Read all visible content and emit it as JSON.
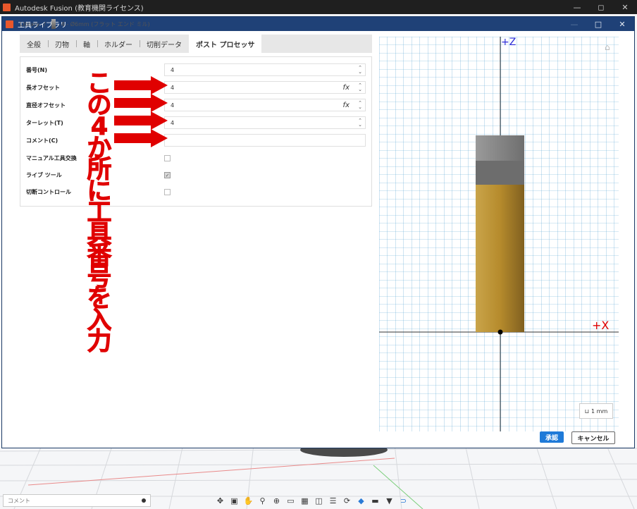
{
  "app": {
    "title": "Autodesk Fusion (教育機関ライセンス)",
    "window_controls": [
      "—",
      "◻",
      "✕"
    ]
  },
  "dialog": {
    "title": "工具ライブラリ",
    "window_controls": [
      "—",
      "□",
      "✕"
    ],
    "breadcrumb": {
      "root": "Library",
      "separator": "/",
      "tool": "4 - Ø6mm (フラット エンド ミル)"
    },
    "tabs": [
      {
        "label": "全般"
      },
      {
        "label": "刃物"
      },
      {
        "label": "軸"
      },
      {
        "label": "ホルダー"
      },
      {
        "label": "切削データ"
      },
      {
        "label": "ポスト プロセッサ",
        "active": true
      }
    ],
    "fields": {
      "number": {
        "label": "番号(N)",
        "value": "4"
      },
      "length_offset": {
        "label": "長オフセット",
        "value": "4",
        "fx": "fx"
      },
      "diameter_offset": {
        "label": "直径オフセット",
        "value": "4",
        "fx": "fx"
      },
      "turret": {
        "label": "ターレット(T)",
        "value": "4"
      },
      "comment": {
        "label": "コメント(C)",
        "value": ""
      },
      "manual_tool_change": {
        "label": "マニュアル工具交換",
        "checked": false
      },
      "live_tool": {
        "label": "ライブ ツール",
        "checked": true
      },
      "break_control": {
        "label": "切断コントロール",
        "checked": false
      }
    },
    "annotation": "この4か所に工具番号を入力",
    "preview": {
      "z_axis": "+Z",
      "x_axis": "+X",
      "scale": "1 mm"
    },
    "buttons": {
      "ok": "承認",
      "cancel": "キャンセル"
    }
  },
  "bottom": {
    "comment_placeholder": "コメント",
    "toolbar_icons": [
      "move-icon",
      "capture-icon",
      "pan-icon",
      "zoom-icon",
      "fit-icon",
      "display-icon",
      "grid-icon",
      "view-icon",
      "layout-icon",
      "orbit-icon",
      "appearance-icon",
      "effects-icon",
      "filter-icon",
      "snap-icon"
    ]
  },
  "colors": {
    "dialog_titlebar": "#1f4177",
    "annotation": "#e00000",
    "ok_button": "#1f7ad8",
    "tool_body": "#c39a3c",
    "tool_holder": "#888888"
  }
}
